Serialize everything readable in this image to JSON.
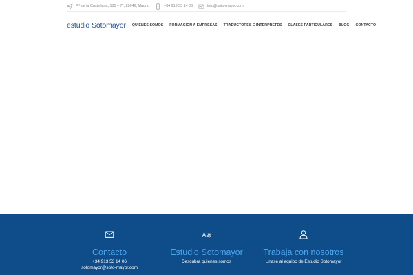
{
  "topbar": {
    "address": "P.º de la Castellana, 135 – 7º, 28046, Madrid",
    "phone": "+34 913 53 14 06",
    "email": "info@soto-mayor.com"
  },
  "header": {
    "logo": "estudio Sotomayor",
    "nav": [
      "QUIENES SOMOS",
      "FORMACIÓN A EMPRESAS",
      "TRADUCTORES E INTÉRPRETES",
      "CLASES PARTICULARES",
      "BLOG",
      "CONTACTO"
    ]
  },
  "footer": {
    "contact": {
      "title": "Contacto",
      "phone": "+34 913 53 14 06",
      "email": "sotomayor@soto-mayor.com",
      "icon": "envelope-icon"
    },
    "about": {
      "title": "Estudio Sotomayor",
      "text": "Descubra quienes somos",
      "icon": "translate-icon"
    },
    "jobs": {
      "title": "Trabaja con nosotros",
      "text": "Únase al equipo de Estudio Sotomayor",
      "icon": "user-icon"
    }
  },
  "colors": {
    "footer_bg": "#0f4d8a",
    "footer_title": "#4fa3e8",
    "logo": "#1f4f8a"
  }
}
